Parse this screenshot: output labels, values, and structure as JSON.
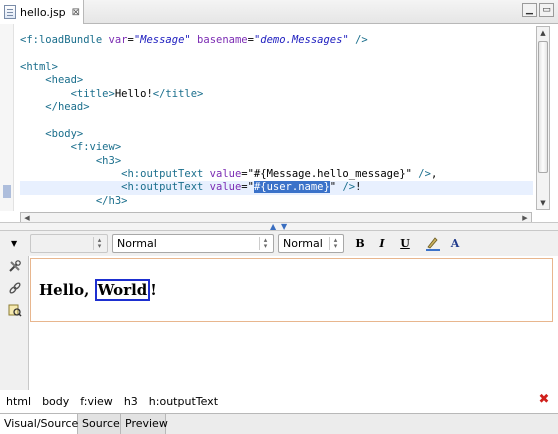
{
  "editor_tab": {
    "title": "hello.jsp",
    "close_glyph": "⊠"
  },
  "window_buttons": {
    "minimize": "▁",
    "maximize": "▭"
  },
  "source": {
    "lines": [
      {
        "parts": [
          [
            "tg",
            "<f:loadBundle "
          ],
          [
            "an",
            "var"
          ],
          [
            "",
            "="
          ],
          [
            "av",
            "\"Message\""
          ],
          [
            "",
            " "
          ],
          [
            "an",
            "basename"
          ],
          [
            "",
            "="
          ],
          [
            "av",
            "\"demo.Messages\""
          ],
          [
            "tg",
            " />"
          ]
        ]
      },
      {
        "parts": []
      },
      {
        "parts": [
          [
            "tg",
            "<html>"
          ]
        ]
      },
      {
        "parts": [
          [
            "",
            "    "
          ],
          [
            "tg",
            "<head>"
          ]
        ]
      },
      {
        "parts": [
          [
            "",
            "        "
          ],
          [
            "tg",
            "<title>"
          ],
          [
            "",
            "Hello!"
          ],
          [
            "tg",
            "</title>"
          ]
        ]
      },
      {
        "parts": [
          [
            "",
            "    "
          ],
          [
            "tg",
            "</head>"
          ]
        ]
      },
      {
        "parts": []
      },
      {
        "parts": [
          [
            "",
            "    "
          ],
          [
            "tg",
            "<body>"
          ]
        ]
      },
      {
        "parts": [
          [
            "",
            "        "
          ],
          [
            "tg",
            "<f:view>"
          ]
        ]
      },
      {
        "parts": [
          [
            "",
            "            "
          ],
          [
            "tg",
            "<h3>"
          ]
        ]
      },
      {
        "parts": [
          [
            "",
            "                "
          ],
          [
            "tg",
            "<h:outputText "
          ],
          [
            "an",
            "value"
          ],
          [
            "",
            "=\"#{Message.hello_message}\" "
          ],
          [
            "tg",
            "/>"
          ],
          [
            "",
            ","
          ]
        ]
      },
      {
        "parts": [
          [
            "",
            "                "
          ],
          [
            "tg",
            "<h:outputText "
          ],
          [
            "an",
            "value"
          ],
          [
            "",
            "=\""
          ],
          [
            "sel",
            "#{user.name}"
          ],
          [
            "",
            "\" "
          ],
          [
            "tg",
            "/>"
          ],
          [
            "",
            "!"
          ]
        ],
        "current": true
      },
      {
        "parts": [
          [
            "",
            "            "
          ],
          [
            "tg",
            "</h3>"
          ]
        ]
      }
    ]
  },
  "toolbar": {
    "style_combo": "",
    "format_combo": "Normal",
    "size_combo": "Normal",
    "bold": "B",
    "italic": "I",
    "underline": "U",
    "highlight_icon": "highlight-color-icon",
    "font_color_icon": "font-color-icon",
    "font_color_glyph": "A"
  },
  "visual": {
    "text_before": "Hello, ",
    "output_text": "World",
    "text_after": "!"
  },
  "breadcrumb": [
    "html",
    "body",
    "f:view",
    "h3",
    "h:outputText"
  ],
  "breadcrumb_error_icon": "✖",
  "bottom_tabs": [
    "Visual/Source",
    "Source",
    "Preview"
  ],
  "colors": {
    "tag": "#1a6e8c",
    "attribute_name": "#7b2bb3",
    "attribute_value": "#2020c0",
    "selection": "#3b72c9",
    "output_box": "#1d2fd0",
    "element_box": "#e8b68e",
    "error": "#d0201c"
  }
}
